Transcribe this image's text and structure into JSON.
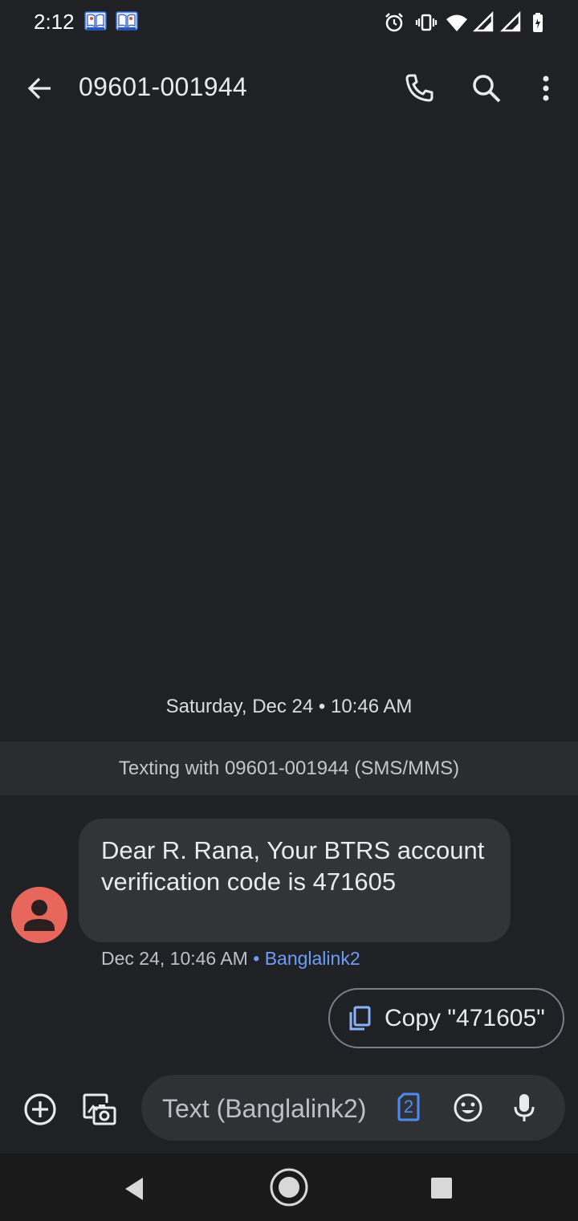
{
  "status_bar": {
    "time": "2:12",
    "notification_icons": [
      "book-app-icon",
      "book-app-icon"
    ],
    "system_icons": [
      "alarm-icon",
      "vibrate-icon",
      "wifi-icon",
      "signal-icon",
      "signal-icon",
      "battery-icon"
    ]
  },
  "app_bar": {
    "title": "09601-001944",
    "actions": [
      "back-arrow-icon",
      "phone-icon",
      "search-icon",
      "more-vert-icon"
    ]
  },
  "conversation": {
    "date_separator": "Saturday, Dec 24 • 10:46 AM",
    "texting_banner": "Texting with 09601-001944 (SMS/MMS)",
    "message": {
      "text": "Dear R. Rana, Your BTRS account verification code is 471605",
      "time": "Dec 24, 10:46 AM",
      "sim_separator": " • ",
      "sim": "Banglalink2"
    },
    "suggestion": {
      "label": "Copy \"471605\"",
      "icon": "copy-icon"
    }
  },
  "composer": {
    "placeholder": "Text (Banglalink2)",
    "sim_badge": "2",
    "buttons": [
      "add-icon",
      "gallery-camera-icon",
      "emoji-icon",
      "mic-icon"
    ]
  },
  "nav": {
    "buttons": [
      "back-triangle-icon",
      "home-circle-icon",
      "recents-square-icon"
    ]
  },
  "colors": {
    "background": "#202124",
    "bubble": "#333436",
    "avatar": "#e8675d",
    "sim_accent": "#6c9ef8",
    "sim_badge": "#4c8bf5"
  }
}
